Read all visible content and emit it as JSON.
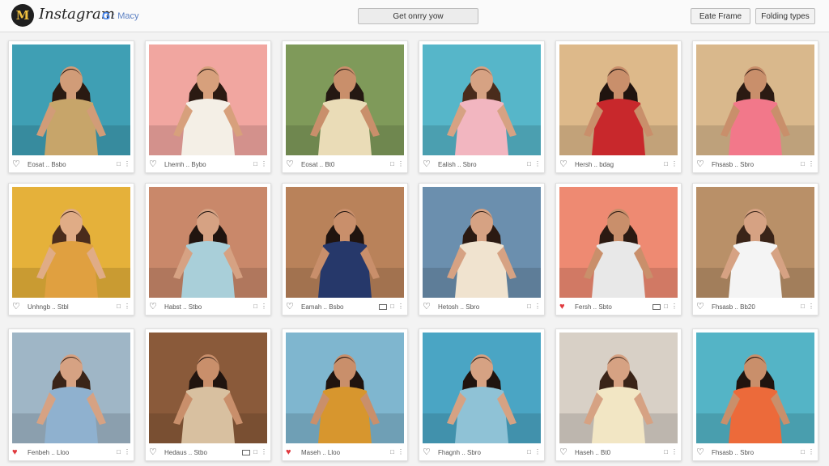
{
  "header": {
    "logo_glyph": "M",
    "brand": "Instagram",
    "account_icon": "G",
    "account_label": ": Macy",
    "center_button": "Get onrry yow",
    "frame_button": "Eate Frame",
    "folding_button": "Folding types"
  },
  "posts": [
    {
      "caption": "Eosat  ..  Bsbo",
      "liked": false,
      "media_icon": false,
      "bg": "#3f9fb4",
      "shirt": "#c7a56a",
      "hair": "#2a1a12",
      "skin": "#d19c78"
    },
    {
      "caption": "Lhemh  ..  Bybo",
      "liked": false,
      "media_icon": false,
      "bg": "#f1a6a0",
      "shirt": "#f4efe6",
      "hair": "#2b1a12",
      "skin": "#d7a07c"
    },
    {
      "caption": "Eosat  ..  Bt0",
      "liked": false,
      "media_icon": false,
      "bg": "#7f9a5a",
      "shirt": "#eadcb7",
      "hair": "#241812",
      "skin": "#c98f6b"
    },
    {
      "caption": "Ealish  ..  Sbro",
      "liked": false,
      "media_icon": false,
      "bg": "#56b6c9",
      "shirt": "#f2b6c0",
      "hair": "#4a2c1c",
      "skin": "#d6a283"
    },
    {
      "caption": "Hersh  ..  bdag",
      "liked": false,
      "media_icon": false,
      "bg": "#ddb98a",
      "shirt": "#c8282c",
      "hair": "#20140f",
      "skin": "#c98f6b"
    },
    {
      "caption": "Fhsasb  ..  Sbro",
      "liked": false,
      "media_icon": false,
      "bg": "#d9b88c",
      "shirt": "#f2788a",
      "hair": "#2b1a12",
      "skin": "#c98f6b"
    },
    {
      "caption": "Unhngb  ..  Stbl",
      "liked": false,
      "media_icon": false,
      "bg": "#e5b13a",
      "shirt": "#e0a040",
      "hair": "#4a2c1c",
      "skin": "#e0ac86"
    },
    {
      "caption": "Habst  ..  Stbo",
      "liked": false,
      "media_icon": false,
      "bg": "#c9886a",
      "shirt": "#a9cfd9",
      "hair": "#20140f",
      "skin": "#d6a283"
    },
    {
      "caption": "Eamah  ..  Bsbo",
      "liked": false,
      "media_icon": true,
      "bg": "#b9825a",
      "shirt": "#26386a",
      "hair": "#20140f",
      "skin": "#c98f6b"
    },
    {
      "caption": "Hetosh  ..  Sbro",
      "liked": false,
      "media_icon": false,
      "bg": "#6b8fae",
      "shirt": "#f0e3cf",
      "hair": "#2b1a12",
      "skin": "#d6a283"
    },
    {
      "caption": "Fersh  ..  Sbto",
      "liked": true,
      "media_icon": true,
      "bg": "#ee8a72",
      "shirt": "#e8e8e8",
      "hair": "#2b1a12",
      "skin": "#c98f6b"
    },
    {
      "caption": "Fhsasb  ..  Bb20",
      "liked": false,
      "media_icon": false,
      "bg": "#b99068",
      "shirt": "#f4f4f4",
      "hair": "#3a2418",
      "skin": "#d6a283"
    },
    {
      "caption": "Fenbeh  ..  Lloo",
      "liked": true,
      "media_icon": false,
      "bg": "#9fb6c6",
      "shirt": "#8fb1cf",
      "hair": "#3a2418",
      "skin": "#d6a283"
    },
    {
      "caption": "Hedaus  ..  Stbo",
      "liked": false,
      "media_icon": true,
      "bg": "#8a5a3a",
      "shirt": "#d8c0a0",
      "hair": "#20140f",
      "skin": "#c98f6b"
    },
    {
      "caption": "Maseh  ..  Lloo",
      "liked": true,
      "media_icon": false,
      "bg": "#7fb6cf",
      "shirt": "#d7962e",
      "hair": "#20140f",
      "skin": "#c98f6b"
    },
    {
      "caption": "Fhagnh  ..  Sbro",
      "liked": false,
      "media_icon": false,
      "bg": "#4aa5c4",
      "shirt": "#8fc2d6",
      "hair": "#20140f",
      "skin": "#d6a283"
    },
    {
      "caption": "Haseh  ..  Bt0",
      "liked": false,
      "media_icon": false,
      "bg": "#d8d0c6",
      "shirt": "#f2e6c4",
      "hair": "#3a2418",
      "skin": "#d6a283"
    },
    {
      "caption": "Fhsasb  ..  Sbro",
      "liked": false,
      "media_icon": false,
      "bg": "#54b4c6",
      "shirt": "#ec6a3a",
      "hair": "#20140f",
      "skin": "#c98f6b"
    }
  ]
}
